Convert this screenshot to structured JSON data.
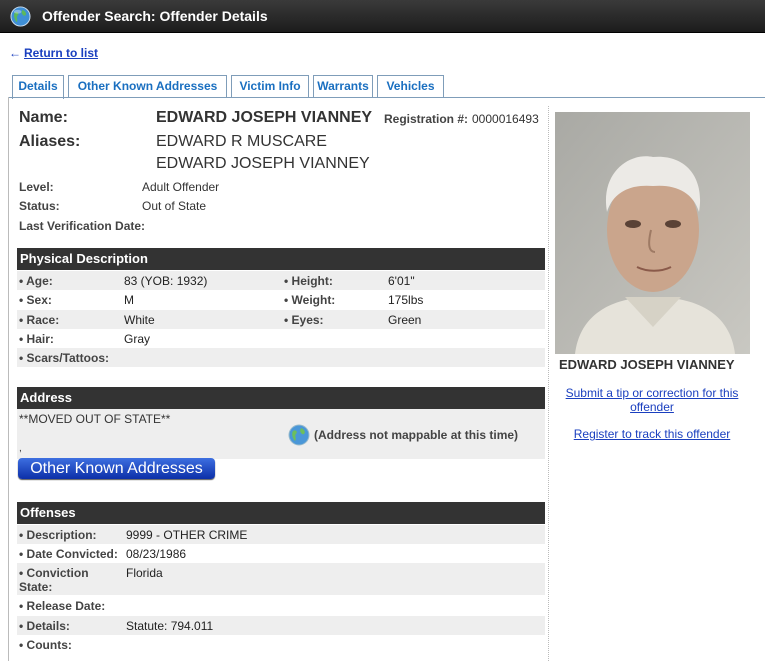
{
  "header": {
    "title": "Offender Search: Offender Details"
  },
  "nav": {
    "back_label": "Return to list"
  },
  "tabs": [
    "Details",
    "Other Known Addresses",
    "Victim Info",
    "Warrants",
    "Vehicles"
  ],
  "summary": {
    "name_label": "Name:",
    "name": "EDWARD JOSEPH VIANNEY",
    "registration_label": "Registration #:",
    "registration": "0000016493",
    "aliases_label": "Aliases:",
    "aliases": [
      "EDWARD R MUSCARE",
      "EDWARD JOSEPH VIANNEY"
    ],
    "level_label": "Level:",
    "level": "Adult Offender",
    "status_label": "Status:",
    "status": "Out of State",
    "verification_label": "Last Verification Date:",
    "verification": ""
  },
  "physical": {
    "title": "Physical Description",
    "age_label": "• Age:",
    "age": "83  (YOB: 1932)",
    "height_label": "• Height:",
    "height": "6'01\"",
    "sex_label": "• Sex:",
    "sex": "M",
    "weight_label": "• Weight:",
    "weight": "175lbs",
    "race_label": "• Race:",
    "race": "White",
    "eyes_label": "• Eyes:",
    "eyes": "Green",
    "hair_label": "• Hair:",
    "hair": "Gray",
    "scars_label": "• Scars/Tattoos:",
    "scars": ""
  },
  "address": {
    "title": "Address",
    "line1": "**MOVED OUT OF STATE**",
    "line2": ",",
    "map_note": "(Address not mappable at this time)",
    "other_button": "Other Known Addresses"
  },
  "offenses": {
    "title": "Offenses",
    "description_label": "• Description:",
    "description": "9999 - OTHER CRIME",
    "convicted_label": "• Date Convicted:",
    "convicted": "08/23/1986",
    "state_label_1": "• Conviction",
    "state_label_2": "State:",
    "state": "Florida",
    "release_label": "• Release Date:",
    "release": "",
    "details_label": "• Details:",
    "details": "Statute: 794.011",
    "counts_label": "• Counts:",
    "counts": ""
  },
  "sidebar": {
    "photo_name": "EDWARD JOSEPH VIANNEY",
    "tip_link_1": "Submit a tip or correction for this",
    "tip_link_2": "offender",
    "track_link": "Register to track this offender"
  },
  "colors": {
    "header_bg": "#2a2a2a",
    "section_bg": "#333333",
    "link": "#1a3fbf",
    "tab_text": "#1a6fc0",
    "button": "#1e44c8"
  }
}
